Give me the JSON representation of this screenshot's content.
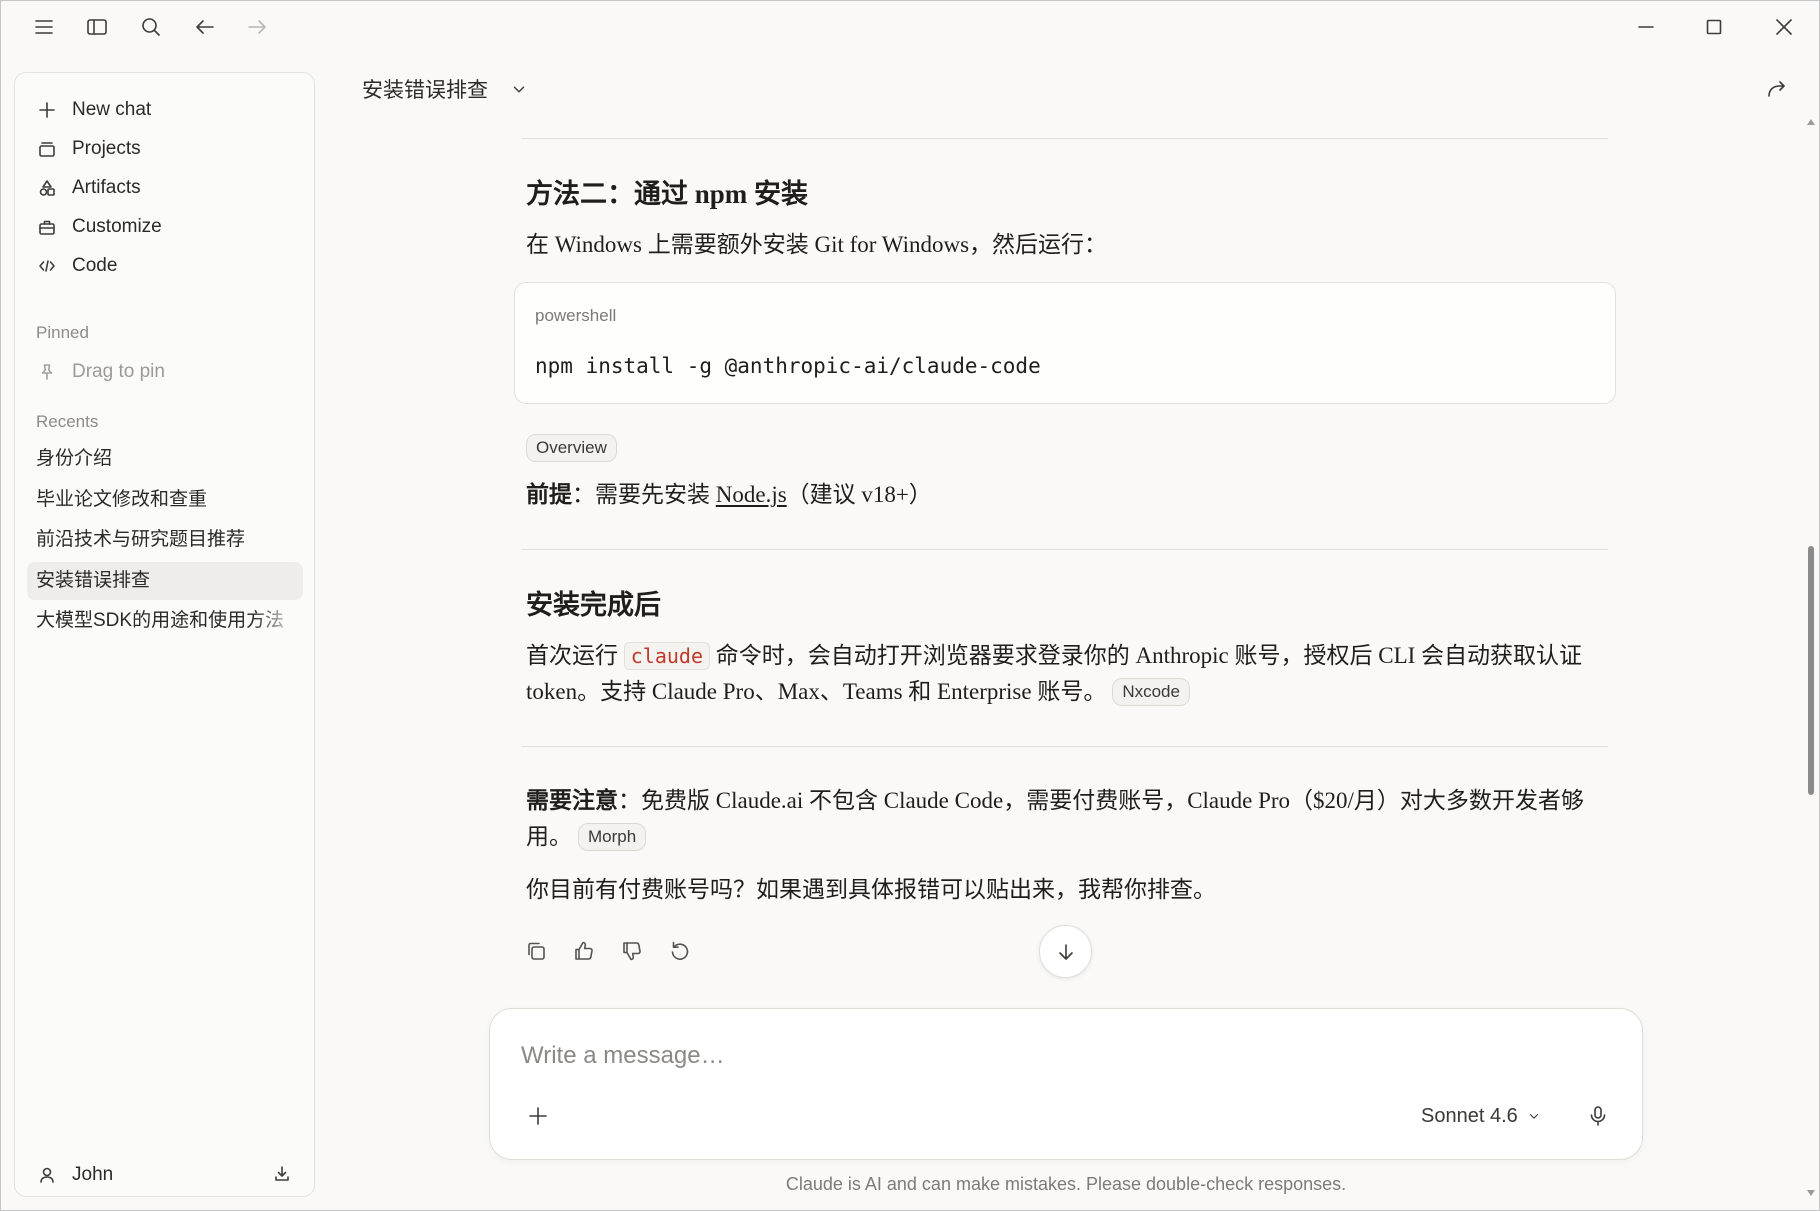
{
  "theme": {
    "background": "#faf9f7",
    "sidebar_background": "#fbfbf9",
    "selected_background": "#eeede9",
    "inline_code_color": "#c0392b"
  },
  "sidebar": {
    "nav": [
      {
        "label": "New chat",
        "icon": "plus-icon"
      },
      {
        "label": "Projects",
        "icon": "projects-icon"
      },
      {
        "label": "Artifacts",
        "icon": "artifacts-icon"
      },
      {
        "label": "Customize",
        "icon": "briefcase-icon"
      },
      {
        "label": "Code",
        "icon": "code-icon"
      }
    ],
    "pinned": {
      "heading": "Pinned",
      "placeholder": "Drag to pin"
    },
    "recents": {
      "heading": "Recents",
      "items": [
        "身份介绍",
        "毕业论文修改和查重",
        "前沿技术与研究题目推荐",
        "安装错误排查",
        "大模型SDK的用途和使用方法"
      ],
      "selected_index": 3
    },
    "user": {
      "name": "John"
    }
  },
  "header": {
    "title": "安装错误排查"
  },
  "conversation": {
    "method_two": {
      "heading": "方法二：通过 npm 安装",
      "intro": "在 Windows 上需要额外安装 Git for Windows，然后运行：",
      "code": {
        "language": "powershell",
        "command": "npm install -g @anthropic-ai/claude-code"
      },
      "source": "Overview",
      "prereq_label": "前提",
      "prereq_before": "：需要先安装 ",
      "prereq_link": "Node.js",
      "prereq_after": "（建议 v18+）"
    },
    "after_install": {
      "heading": "安装完成后",
      "text_before": "首次运行 ",
      "inline_code": "claude",
      "text_after": " 命令时，会自动打开浏览器要求登录你的 Anthropic 账号，授权后 CLI 会自动获取认证 token。支持 Claude Pro、Max、Teams 和 Enterprise 账号。",
      "source": "Nxcode"
    },
    "note": {
      "label": "需要注意",
      "text": "：免费版 Claude.ai 不包含 Claude Code，需要付费账号，Claude Pro（$20/月）对大多数开发者够用。",
      "source": "Morph"
    },
    "closing": "你目前有付费账号吗？如果遇到具体报错可以贴出来，我帮你排查。"
  },
  "composer": {
    "placeholder": "Write a message…",
    "model": "Sonnet 4.6"
  },
  "footer": {
    "disclaimer": "Claude is AI and can make mistakes. Please double-check responses."
  }
}
